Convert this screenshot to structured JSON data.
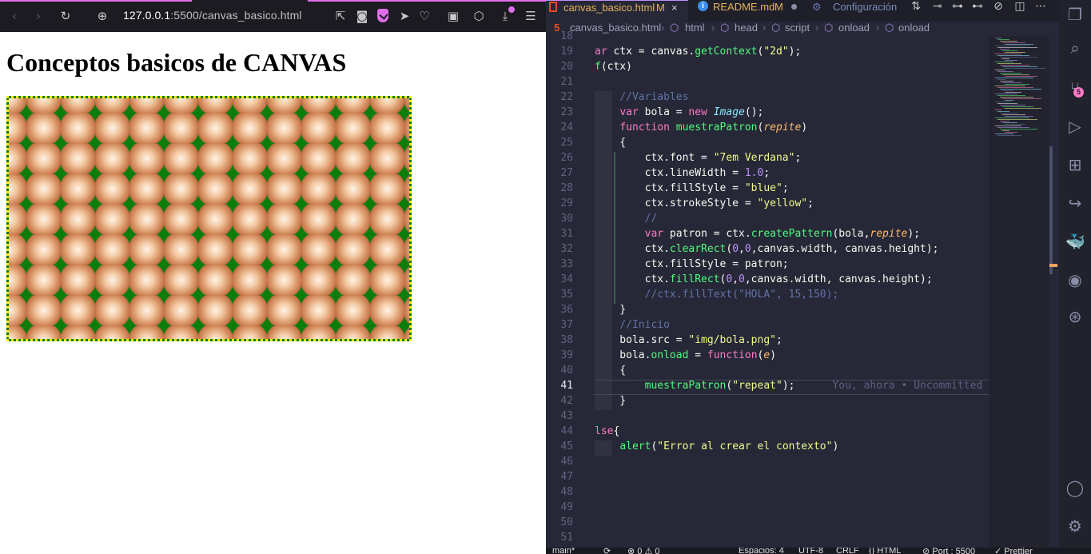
{
  "browser": {
    "url_host": "127.0.0.1",
    "url_rest": ":5500/canvas_basico.html",
    "page_title": "Conceptos basicos de CANVAS",
    "icons": [
      "back-icon",
      "forward-icon",
      "reload-icon",
      "site-info-icon",
      "share-icon",
      "screenshot-icon",
      "vpn-shield-icon",
      "send-icon",
      "heart-icon",
      "extension-icon",
      "cube-icon",
      "download-icon",
      "menu-icon"
    ]
  },
  "editor": {
    "tabs": [
      {
        "label": "canvas_basico.html",
        "status": "M",
        "close": "×"
      },
      {
        "label": "README.md",
        "status": "M"
      },
      {
        "label": "Configuración"
      }
    ],
    "breadcrumb": [
      "canvas_basico.html",
      "html",
      "head",
      "script",
      "onload",
      "onload"
    ],
    "current_line": 41,
    "lines": [
      {
        "n": "18",
        "code": ""
      },
      {
        "n": "19",
        "code": "ar ctx = canvas.getContext(\"2d\");"
      },
      {
        "n": "20",
        "code": "f(ctx)"
      },
      {
        "n": "21",
        "code": ""
      },
      {
        "n": "22",
        "code": "    //Variables"
      },
      {
        "n": "23",
        "code": "    var bola = new Image();"
      },
      {
        "n": "24",
        "code": "    function muestraPatron(repite)"
      },
      {
        "n": "25",
        "code": "    {"
      },
      {
        "n": "26",
        "code": "        ctx.font = \"7em Verdana\";"
      },
      {
        "n": "27",
        "code": "        ctx.lineWidth = 1.0;"
      },
      {
        "n": "28",
        "code": "        ctx.fillStyle = \"blue\";"
      },
      {
        "n": "29",
        "code": "        ctx.strokeStyle = \"yellow\";"
      },
      {
        "n": "30",
        "code": "        //"
      },
      {
        "n": "31",
        "code": "        var patron = ctx.createPattern(bola,repite);"
      },
      {
        "n": "32",
        "code": "        ctx.clearRect(0,0,canvas.width, canvas.height);"
      },
      {
        "n": "33",
        "code": "        ctx.fillStyle = patron;"
      },
      {
        "n": "34",
        "code": "        ctx.fillRect(0,0,canvas.width, canvas.height);"
      },
      {
        "n": "35",
        "code": "        //ctx.fillText(\"HOLA\", 15,150);"
      },
      {
        "n": "36",
        "code": "    }"
      },
      {
        "n": "37",
        "code": "    //Inicio"
      },
      {
        "n": "38",
        "code": "    bola.src = \"img/bola.png\";"
      },
      {
        "n": "39",
        "code": "    bola.onload = function(e)"
      },
      {
        "n": "40",
        "code": "    {"
      },
      {
        "n": "41",
        "code": "        muestraPatron(\"repeat\");"
      },
      {
        "n": "42",
        "code": "    }"
      },
      {
        "n": "43",
        "code": ""
      },
      {
        "n": "44",
        "code": "lse{"
      },
      {
        "n": "45",
        "code": "    alert(\"Error al crear el contexto\")"
      },
      {
        "n": "46",
        "code": ""
      },
      {
        "n": "47",
        "code": ""
      },
      {
        "n": "48",
        "code": ""
      },
      {
        "n": "49",
        "code": ""
      },
      {
        "n": "50",
        "code": ""
      },
      {
        "n": "51",
        "code": ""
      }
    ],
    "ghost_text": "You, ahora • Uncommitted ch",
    "activity_badge": "5",
    "statusbar": {
      "branch": "main*",
      "sync": "⟳",
      "problems": "⊗ 0 ⚠ 0",
      "spaces": "Espacios: 4",
      "encoding": "UTF-8",
      "eol": "CRLF",
      "language": "{} HTML",
      "port": "⊘ Port : 5500",
      "prettier": "✓ Prettier"
    }
  },
  "colors": {
    "accent": "#e06ee8",
    "editor_bg": "#262837",
    "canvas_green": "#0b7d0b",
    "canvas_border": "#ffee00"
  }
}
